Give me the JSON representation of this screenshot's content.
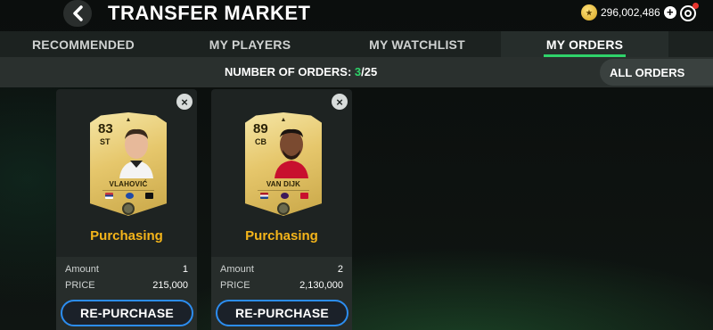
{
  "header": {
    "title": "TRANSFER MARKET",
    "coins": "296,002,486"
  },
  "tabs": [
    {
      "label": "RECOMMENDED",
      "active": false
    },
    {
      "label": "MY PLAYERS",
      "active": false
    },
    {
      "label": "MY WATCHLIST",
      "active": false
    },
    {
      "label": "MY ORDERS",
      "active": true
    }
  ],
  "orders_bar": {
    "label": "NUMBER OF ORDERS:",
    "current": "3",
    "max": "/25",
    "filter": "ALL ORDERS"
  },
  "orders": [
    {
      "rating": "83",
      "position": "ST",
      "name": "VLAHOVIĆ",
      "status": "Purchasing",
      "amount_label": "Amount",
      "amount": "1",
      "price_label": "PRICE",
      "price": "215,000",
      "button": "RE-PURCHASE"
    },
    {
      "rating": "89",
      "position": "CB",
      "name": "VAN DIJK",
      "status": "Purchasing",
      "amount_label": "Amount",
      "amount": "2",
      "price_label": "PRICE",
      "price": "2,130,000",
      "button": "RE-PURCHASE"
    }
  ],
  "colors": {
    "accent_green": "#2fd36a",
    "status_orange": "#f5b51a",
    "button_blue": "#2c8df0"
  }
}
